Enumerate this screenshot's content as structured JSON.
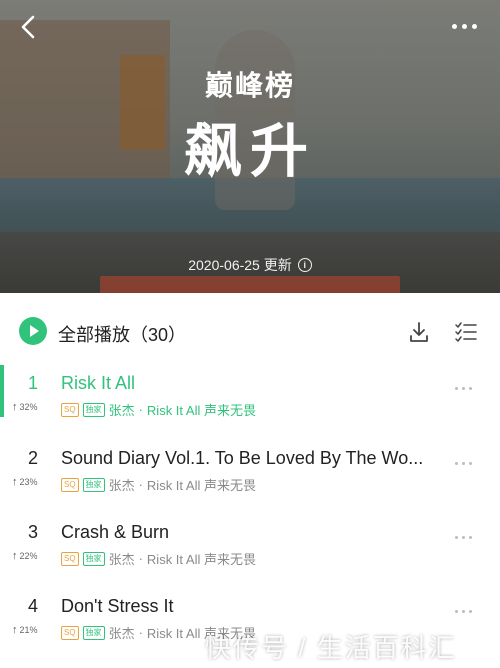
{
  "header": {
    "back_icon": "chevron-left-icon",
    "more_icon": "more-horizontal-icon",
    "brand_logo": "巅峰榜",
    "title": "飙升",
    "update_text": "2020-06-25 更新",
    "info_icon": "info-circle-icon"
  },
  "play_all": {
    "label": "全部播放（30）",
    "icon": "play-circle-icon",
    "download_icon": "download-icon",
    "multi_select_icon": "multi-select-list-icon"
  },
  "songs": [
    {
      "rank": "1",
      "trend": "32%",
      "title": "Risk It All",
      "tags": [
        "SQ",
        "独家"
      ],
      "artist": "张杰",
      "album": "Risk It All 声来无畏",
      "playing": true
    },
    {
      "rank": "2",
      "trend": "23%",
      "title": "Sound Diary Vol.1. To Be Loved By The Wo...",
      "tags": [
        "SQ",
        "独家"
      ],
      "artist": "张杰",
      "album": "Risk It All 声来无畏",
      "playing": false
    },
    {
      "rank": "3",
      "trend": "22%",
      "title": "Crash & Burn",
      "tags": [
        "SQ",
        "独家"
      ],
      "artist": "张杰",
      "album": "Risk It All 声来无畏",
      "playing": false
    },
    {
      "rank": "4",
      "trend": "21%",
      "title": "Don't Stress It",
      "tags": [
        "SQ",
        "独家"
      ],
      "artist": "张杰",
      "album": "Risk It All 声来无畏",
      "playing": false
    }
  ],
  "separator": "·",
  "watermark": "快传号 / 生活百科汇",
  "colors": {
    "accent": "#31c27c",
    "sq_tag": "#e8a33c"
  }
}
